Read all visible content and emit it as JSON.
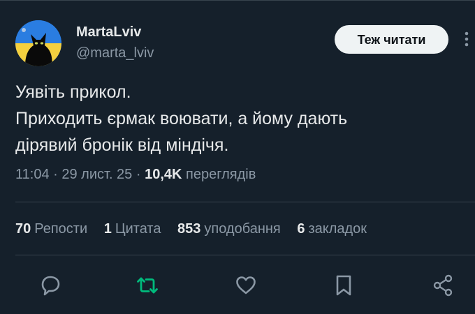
{
  "author": {
    "name": "MartaLviv",
    "handle": "@marta_lviv"
  },
  "header": {
    "follow_label": "Теж читати"
  },
  "tweet": {
    "lines": [
      "Уявіть прикол.",
      "Приходить єрмак воювати, а йому дають",
      "дірявий бронік від міндічя."
    ],
    "time": "11:04",
    "date": "29 лист. 25",
    "views_count": "10,4K",
    "views_label": "переглядів"
  },
  "stats": {
    "reposts": {
      "count": "70",
      "label": "Репости"
    },
    "quotes": {
      "count": "1",
      "label": "Цитата"
    },
    "likes": {
      "count": "853",
      "label": "уподобання"
    },
    "bookmarks": {
      "count": "6",
      "label": "закладок"
    }
  },
  "actions": {
    "reply_icon": "reply-icon",
    "repost_icon": "repost-icon",
    "like_icon": "heart-icon",
    "bookmark_icon": "bookmark-icon",
    "share_icon": "share-icon"
  },
  "colors": {
    "background": "#15202b",
    "text": "#e7e9ea",
    "muted": "#8b98a5",
    "divider": "#38444d",
    "repost_green": "#00ba7c",
    "button_bg": "#eff3f4"
  }
}
